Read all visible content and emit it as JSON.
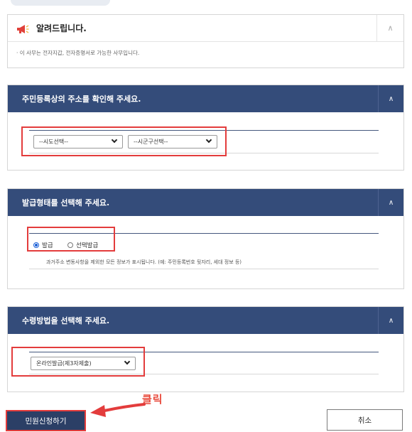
{
  "notice": {
    "title": "알려드립니다.",
    "body": "· 이 사무는 전자지갑, 전자증명서로 가능한 사무입니다."
  },
  "address_section": {
    "title": "주민등록상의 주소를 확인해 주세요.",
    "sido_select": "--시도선택--",
    "sigungu_select": "--시군구선택--"
  },
  "issue_type_section": {
    "title": "발급형태를 선택해 주세요.",
    "options": [
      "발급",
      "선택발급"
    ],
    "selected": "발급",
    "description": "과거주소 변동사항을 제외한 모든 정보가 표시됩니다. (예: 주민등록번호 뒷자리, 세대 정보 등)"
  },
  "receive_section": {
    "title": "수령방법을 선택해 주세요.",
    "method_select": "온라인발급(제3자제출)"
  },
  "footer": {
    "apply_label": "민원신청하기",
    "cancel_label": "취소",
    "click_annotation": "클릭"
  },
  "colors": {
    "header_bg": "#344c7a",
    "annotation_red": "#e33c3c"
  }
}
